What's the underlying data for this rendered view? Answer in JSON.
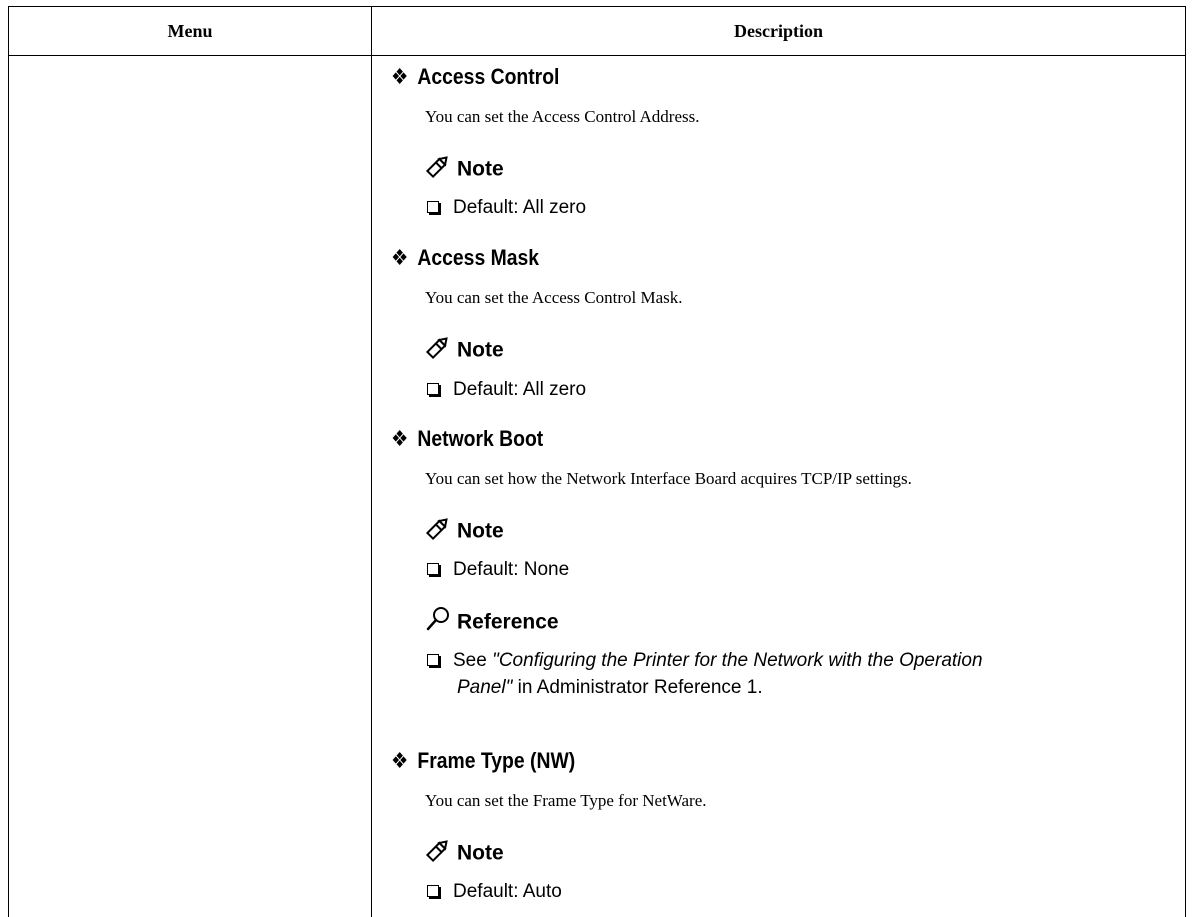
{
  "table": {
    "header_menu": "Menu",
    "header_description": "Description"
  },
  "entries": [
    {
      "title": "Access Control",
      "description": "You can set the Access Control Address.",
      "note_heading": "Note",
      "note_text": "Default: All zero"
    },
    {
      "title": "Access Mask",
      "description": "You can set the Access Control Mask.",
      "note_heading": "Note",
      "note_text": "Default: All zero"
    },
    {
      "title": "Network Boot",
      "description": "You can set how the Network Interface Board acquires TCP/IP settings.",
      "note_heading": "Note",
      "note_text": "Default: None",
      "reference_heading": "Reference",
      "reference_prefix": "See ",
      "reference_italic_1": "\"Configuring the Printer for the Network with the Operation",
      "reference_italic_2": "Panel\"",
      "reference_suffix": " in Administrator Reference 1."
    },
    {
      "title": "Frame Type (NW)",
      "description": "You can set the Frame Type for NetWare.",
      "note_heading": "Note",
      "note_text": "Default: Auto"
    }
  ],
  "glyphs": {
    "diamond": "❖"
  }
}
